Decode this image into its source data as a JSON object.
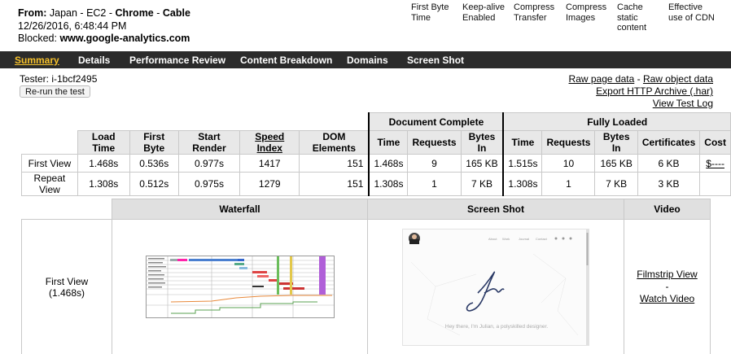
{
  "header": {
    "from_label": "From:",
    "location": "Japan - EC2",
    "sep1": "-",
    "browser": "Chrome",
    "sep2": "-",
    "connection": "Cable",
    "datetime": "12/26/2016, 6:48:44 PM",
    "blocked_label": "Blocked:",
    "blocked_value": "www.google-analytics.com"
  },
  "grades": [
    {
      "line1": "First Byte",
      "line2": "Time",
      "line3": ""
    },
    {
      "line1": "Keep-alive",
      "line2": "Enabled",
      "line3": ""
    },
    {
      "line1": "Compress",
      "line2": "Transfer",
      "line3": ""
    },
    {
      "line1": "Compress",
      "line2": "Images",
      "line3": ""
    },
    {
      "line1": "Cache",
      "line2": "static",
      "line3": "content"
    },
    {
      "line1": "Effective",
      "line2": "use of CDN",
      "line3": ""
    }
  ],
  "nav": [
    "Summary",
    "Details",
    "Performance Review",
    "Content Breakdown",
    "Domains",
    "Screen Shot"
  ],
  "tester": "Tester: i-1bcf2495",
  "rerun_label": "Re-run the test",
  "links": {
    "raw_page": "Raw page data",
    "dash": " - ",
    "raw_object": "Raw object data",
    "export_har": "Export HTTP Archive (.har)",
    "view_log": "View Test Log"
  },
  "results": {
    "group_doc": "Document Complete",
    "group_full": "Fully Loaded",
    "headers": [
      "Load Time",
      "First Byte",
      "Start Render",
      "Speed Index",
      "DOM Elements",
      "Time",
      "Requests",
      "Bytes In",
      "Time",
      "Requests",
      "Bytes In",
      "Certificates",
      "Cost"
    ],
    "rows": [
      {
        "label": "First View",
        "cells": [
          "1.468s",
          "0.536s",
          "0.977s",
          "1417",
          "151",
          "1.468s",
          "9",
          "165 KB",
          "1.515s",
          "10",
          "165 KB",
          "6 KB",
          "$----"
        ]
      },
      {
        "label": "Repeat View",
        "cells": [
          "1.308s",
          "0.512s",
          "0.975s",
          "1279",
          "151",
          "1.308s",
          "1",
          "7 KB",
          "1.308s",
          "1",
          "7 KB",
          "3 KB",
          ""
        ]
      }
    ]
  },
  "media": {
    "headers": [
      "Waterfall",
      "Screen Shot",
      "Video"
    ],
    "row_label": "First View",
    "row_time": "(1.468s)",
    "filmstrip": "Filmstrip View",
    "dash": "-",
    "watch": "Watch Video",
    "shot_nav": [
      "About",
      "Work",
      "Journal",
      "Contact"
    ],
    "shot_tagline": "Hey there, I'm Julian, a polyskilled designer."
  }
}
